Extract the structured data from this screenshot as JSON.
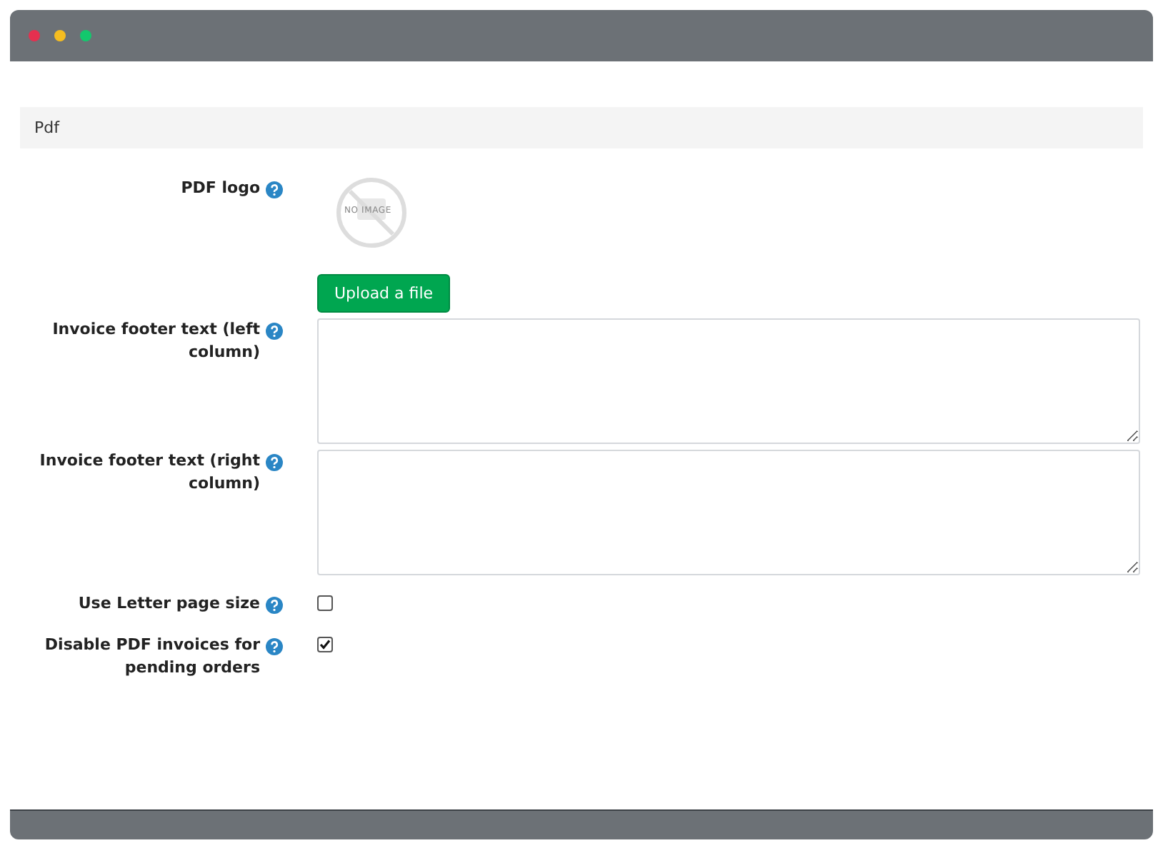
{
  "section": {
    "title": "Pdf"
  },
  "fields": [
    {
      "kind": "image",
      "label": "PDF logo",
      "image_text": "NO IMAGE",
      "button": "Upload a file"
    },
    {
      "kind": "textarea",
      "label": "Invoice footer text (left column)"
    },
    {
      "kind": "textarea",
      "label": "Invoice footer text (right column)"
    },
    {
      "kind": "checkbox",
      "label": "Use Letter page size",
      "checked": false
    },
    {
      "kind": "checkbox",
      "label": "Disable PDF invoices for pending orders",
      "checked": true
    }
  ]
}
